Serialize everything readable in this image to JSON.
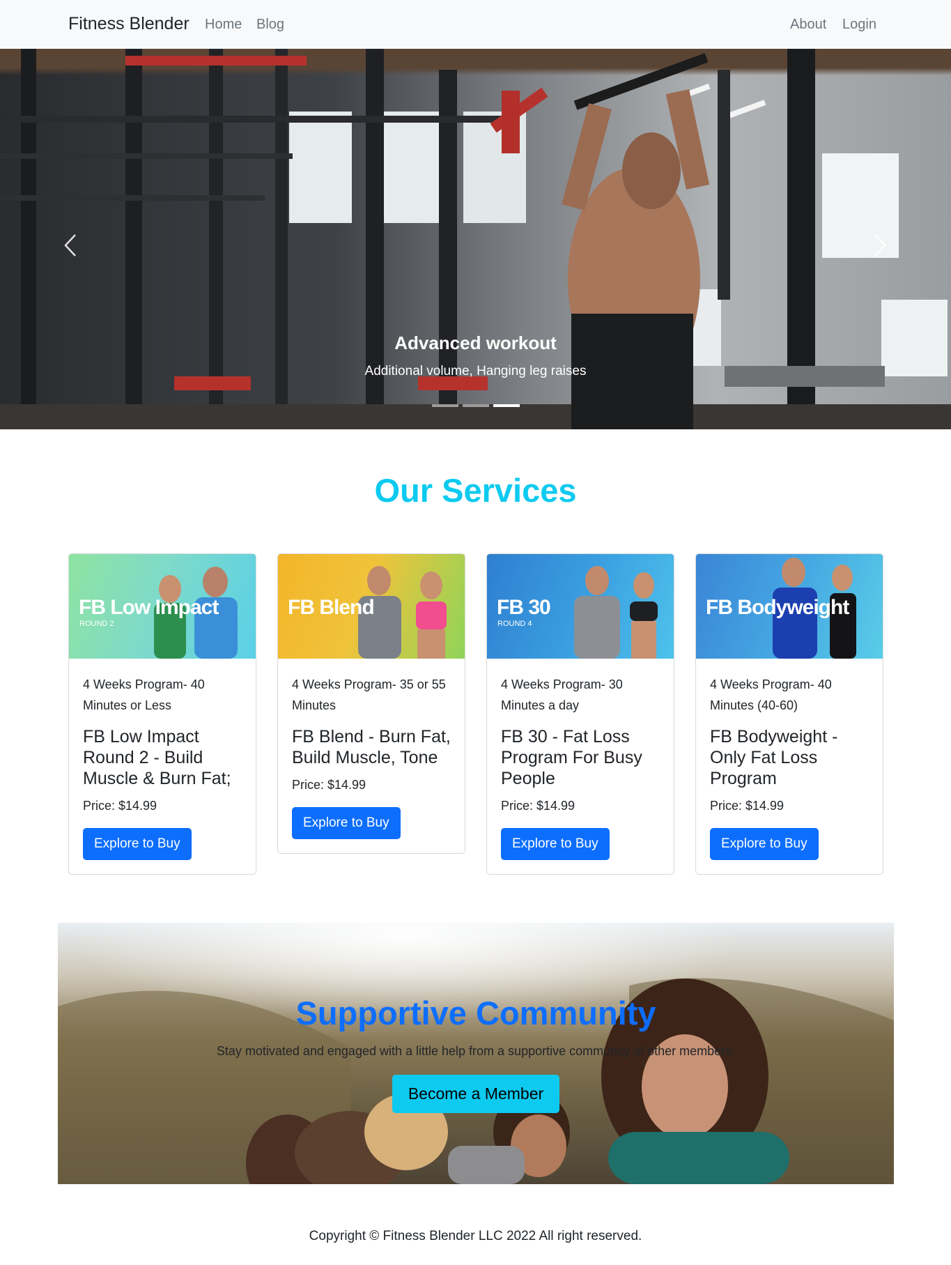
{
  "navbar": {
    "brand": "Fitness Blender",
    "left_links": [
      "Home",
      "Blog"
    ],
    "right_links": [
      "About",
      "Login"
    ]
  },
  "hero": {
    "title": "Advanced workout",
    "subtitle": "Additional volume, Hanging leg raises",
    "slide_count": 3,
    "active_slide": 3,
    "prev_icon": "chevron-left-icon",
    "next_icon": "chevron-right-icon"
  },
  "services": {
    "heading": "Our Services",
    "cards": [
      {
        "logo": "FB Low Impact",
        "round": "ROUND 2",
        "subtitle": "4 Weeks Program- 40 Minutes or Less",
        "title": "FB Low Impact Round 2 - Build Muscle & Burn Fat;",
        "price": "Price: $14.99",
        "button": "Explore to Buy"
      },
      {
        "logo": "FB Blend",
        "round": "",
        "subtitle": "4 Weeks Program- 35 or 55 Minutes",
        "title": "FB Blend - Burn Fat, Build Muscle, Tone",
        "price": "Price: $14.99",
        "button": "Explore to Buy"
      },
      {
        "logo": "FB 30",
        "round": "ROUND 4",
        "subtitle": "4 Weeks Program- 30 Minutes a day",
        "title": "FB 30 - Fat Loss Program For Busy People",
        "price": "Price: $14.99",
        "button": "Explore to Buy"
      },
      {
        "logo": "FB Bodyweight",
        "round": "",
        "subtitle": "4 Weeks Program- 40 Minutes (40-60)",
        "title": "FB Bodyweight - Only Fat Loss Program",
        "price": "Price: $14.99",
        "button": "Explore to Buy"
      }
    ]
  },
  "community": {
    "title": "Supportive Community",
    "text": "Stay motivated and engaged with a little help from a supportive community of other members.",
    "button": "Become a Member"
  },
  "footer": {
    "text": "Copyright © Fitness Blender LLC 2022 All right reserved."
  },
  "colors": {
    "navbar_bg": "#f8f9fa",
    "primary": "#0d6efd",
    "info": "#0dcaf0",
    "text": "#212529",
    "muted": "#6c757d"
  }
}
